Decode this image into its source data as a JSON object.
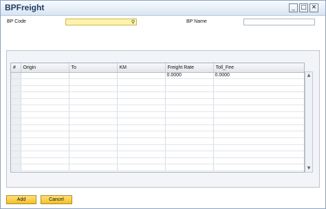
{
  "window": {
    "title": "BPFreight",
    "controls": {
      "minimize": "_",
      "maximize": "□",
      "close": "✕"
    }
  },
  "header": {
    "bp_code_label": "BP Code",
    "bp_code_value": "",
    "bp_code_lookup_icon": "search-icon",
    "bp_name_label": "BP Name",
    "bp_name_value": ""
  },
  "grid": {
    "columns": [
      "#",
      "Origin",
      "To",
      "KM",
      "Freight Rate",
      "Toll_Fee"
    ],
    "rows": [
      [
        "",
        "",
        "",
        "",
        "0.0000",
        "0.0000"
      ],
      [
        "",
        "",
        "",
        "",
        "",
        ""
      ],
      [
        "",
        "",
        "",
        "",
        "",
        ""
      ],
      [
        "",
        "",
        "",
        "",
        "",
        ""
      ],
      [
        "",
        "",
        "",
        "",
        "",
        ""
      ],
      [
        "",
        "",
        "",
        "",
        "",
        ""
      ],
      [
        "",
        "",
        "",
        "",
        "",
        ""
      ],
      [
        "",
        "",
        "",
        "",
        "",
        ""
      ],
      [
        "",
        "",
        "",
        "",
        "",
        ""
      ],
      [
        "",
        "",
        "",
        "",
        "",
        ""
      ],
      [
        "",
        "",
        "",
        "",
        "",
        ""
      ],
      [
        "",
        "",
        "",
        "",
        "",
        ""
      ],
      [
        "",
        "",
        "",
        "",
        "",
        ""
      ],
      [
        "",
        "",
        "",
        "",
        "",
        ""
      ],
      [
        "",
        "",
        "",
        "",
        "",
        ""
      ]
    ]
  },
  "footer": {
    "add_label": "Add",
    "cancel_label": "Cancel"
  },
  "colors": {
    "active_field": "#fff3a8",
    "button": "#f4be2a",
    "title_text": "#1f3d63"
  }
}
